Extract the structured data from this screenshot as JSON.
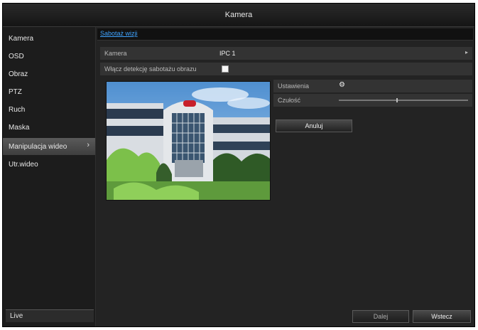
{
  "window": {
    "title": "Kamera"
  },
  "sidebar": {
    "items": [
      {
        "label": "Kamera"
      },
      {
        "label": "OSD"
      },
      {
        "label": "Obraz"
      },
      {
        "label": "PTZ"
      },
      {
        "label": "Ruch"
      },
      {
        "label": "Maska"
      },
      {
        "label": "Manipulacja wideo",
        "active": true
      },
      {
        "label": "Utr.wideo"
      }
    ],
    "live_label": "Live"
  },
  "tabs": [
    {
      "label": "Sabotaż wizji"
    }
  ],
  "form": {
    "camera_label": "Kamera",
    "camera_value": "IPC 1",
    "enable_label": "Włącz detekcję sabotażu obrazu",
    "enable_checked": true,
    "settings_label": "Ustawienia",
    "settings_icon": "gear-icon",
    "sensitivity_label": "Czułość",
    "sensitivity_level": 0.45,
    "cancel_label": "Anuluj"
  },
  "footer": {
    "next_label": "Dalej",
    "back_label": "Wstecz"
  },
  "colors": {
    "link": "#3fa3ff",
    "active_nav": "#4a4a4a",
    "sky": "#6fa4d6"
  }
}
